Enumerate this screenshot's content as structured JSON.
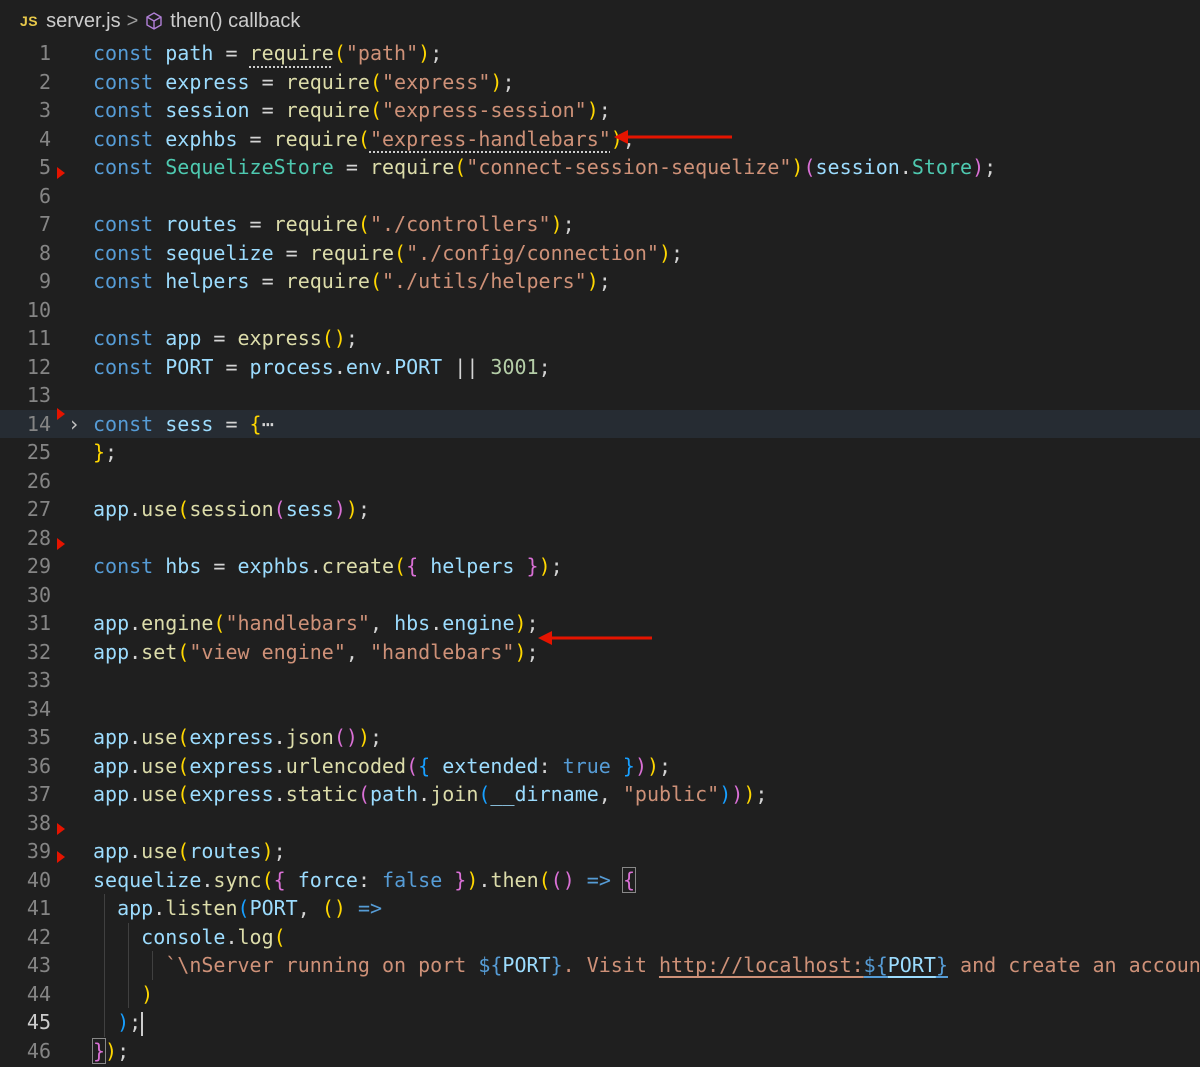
{
  "breadcrumb": {
    "file_badge": "JS",
    "file_name": "server.js",
    "separator": ">",
    "symbol": "then() callback"
  },
  "editor": {
    "current_line": "45",
    "lines": [
      {
        "n": "1",
        "tokens": [
          [
            "kw",
            "const "
          ],
          [
            "vr",
            "path"
          ],
          [
            "op",
            " = "
          ],
          [
            "fn dots",
            "require"
          ],
          [
            "b1",
            "("
          ],
          [
            "st",
            "\"path\""
          ],
          [
            "b1",
            ")"
          ],
          [
            "op",
            ";"
          ]
        ]
      },
      {
        "n": "2",
        "tokens": [
          [
            "kw",
            "const "
          ],
          [
            "vr",
            "express"
          ],
          [
            "op",
            " = "
          ],
          [
            "fn",
            "require"
          ],
          [
            "b1",
            "("
          ],
          [
            "st",
            "\"express\""
          ],
          [
            "b1",
            ")"
          ],
          [
            "op",
            ";"
          ]
        ]
      },
      {
        "n": "3",
        "tokens": [
          [
            "kw",
            "const "
          ],
          [
            "vr",
            "session"
          ],
          [
            "op",
            " = "
          ],
          [
            "fn",
            "require"
          ],
          [
            "b1",
            "("
          ],
          [
            "st",
            "\"express-session\""
          ],
          [
            "b1",
            ")"
          ],
          [
            "op",
            ";"
          ]
        ]
      },
      {
        "n": "4",
        "tokens": [
          [
            "kw",
            "const "
          ],
          [
            "vr",
            "exphbs"
          ],
          [
            "op",
            " = "
          ],
          [
            "fn",
            "require"
          ],
          [
            "b1",
            "("
          ],
          [
            "st dots",
            "\"express-handlebars\""
          ],
          [
            "b1",
            ")"
          ],
          [
            "op",
            ";"
          ]
        ]
      },
      {
        "n": "5",
        "tokens": [
          [
            "kw",
            "const "
          ],
          [
            "cl",
            "SequelizeStore"
          ],
          [
            "op",
            " = "
          ],
          [
            "fn",
            "require"
          ],
          [
            "b1",
            "("
          ],
          [
            "st",
            "\"connect-session-sequelize\""
          ],
          [
            "b1",
            ")"
          ],
          [
            "b2",
            "("
          ],
          [
            "vr",
            "session"
          ],
          [
            "op",
            "."
          ],
          [
            "cl",
            "Store"
          ],
          [
            "b2",
            ")"
          ],
          [
            "op",
            ";"
          ]
        ]
      },
      {
        "n": "6",
        "tokens": []
      },
      {
        "n": "7",
        "tokens": [
          [
            "kw",
            "const "
          ],
          [
            "vr",
            "routes"
          ],
          [
            "op",
            " = "
          ],
          [
            "fn",
            "require"
          ],
          [
            "b1",
            "("
          ],
          [
            "st",
            "\"./controllers\""
          ],
          [
            "b1",
            ")"
          ],
          [
            "op",
            ";"
          ]
        ]
      },
      {
        "n": "8",
        "tokens": [
          [
            "kw",
            "const "
          ],
          [
            "vr",
            "sequelize"
          ],
          [
            "op",
            " = "
          ],
          [
            "fn",
            "require"
          ],
          [
            "b1",
            "("
          ],
          [
            "st",
            "\"./config/connection\""
          ],
          [
            "b1",
            ")"
          ],
          [
            "op",
            ";"
          ]
        ]
      },
      {
        "n": "9",
        "tokens": [
          [
            "kw",
            "const "
          ],
          [
            "vr",
            "helpers"
          ],
          [
            "op",
            " = "
          ],
          [
            "fn",
            "require"
          ],
          [
            "b1",
            "("
          ],
          [
            "st",
            "\"./utils/helpers\""
          ],
          [
            "b1",
            ")"
          ],
          [
            "op",
            ";"
          ]
        ]
      },
      {
        "n": "10",
        "tokens": []
      },
      {
        "n": "11",
        "tokens": [
          [
            "kw",
            "const "
          ],
          [
            "vr",
            "app"
          ],
          [
            "op",
            " = "
          ],
          [
            "fn",
            "express"
          ],
          [
            "b1",
            "()"
          ],
          [
            "op",
            ";"
          ]
        ]
      },
      {
        "n": "12",
        "tokens": [
          [
            "kw",
            "const "
          ],
          [
            "vr",
            "PORT"
          ],
          [
            "op",
            " = "
          ],
          [
            "vr",
            "process"
          ],
          [
            "op",
            "."
          ],
          [
            "vr",
            "env"
          ],
          [
            "op",
            "."
          ],
          [
            "vr",
            "PORT"
          ],
          [
            "op",
            " || "
          ],
          [
            "nm",
            "3001"
          ],
          [
            "op",
            ";"
          ]
        ]
      },
      {
        "n": "13",
        "tokens": []
      },
      {
        "n": "14",
        "tokens": [
          [
            "kw",
            "const "
          ],
          [
            "vr",
            "sess"
          ],
          [
            "op",
            " = "
          ],
          [
            "b1",
            "{"
          ],
          [
            "op",
            "⋯"
          ]
        ]
      },
      {
        "n": "25",
        "tokens": [
          [
            "b1",
            "}"
          ],
          [
            "op",
            ";"
          ]
        ]
      },
      {
        "n": "26",
        "tokens": []
      },
      {
        "n": "27",
        "tokens": [
          [
            "vr",
            "app"
          ],
          [
            "op",
            "."
          ],
          [
            "fn",
            "use"
          ],
          [
            "b1",
            "("
          ],
          [
            "fn",
            "session"
          ],
          [
            "b2",
            "("
          ],
          [
            "vr",
            "sess"
          ],
          [
            "b2",
            ")"
          ],
          [
            "b1",
            ")"
          ],
          [
            "op",
            ";"
          ]
        ]
      },
      {
        "n": "28",
        "tokens": []
      },
      {
        "n": "29",
        "tokens": [
          [
            "kw",
            "const "
          ],
          [
            "vr",
            "hbs"
          ],
          [
            "op",
            " = "
          ],
          [
            "vr",
            "exphbs"
          ],
          [
            "op",
            "."
          ],
          [
            "fn",
            "create"
          ],
          [
            "b1",
            "("
          ],
          [
            "b2",
            "{ "
          ],
          [
            "vr",
            "helpers"
          ],
          [
            "b2",
            " }"
          ],
          [
            "b1",
            ")"
          ],
          [
            "op",
            ";"
          ]
        ]
      },
      {
        "n": "30",
        "tokens": []
      },
      {
        "n": "31",
        "tokens": [
          [
            "vr",
            "app"
          ],
          [
            "op",
            "."
          ],
          [
            "fn",
            "engine"
          ],
          [
            "b1",
            "("
          ],
          [
            "st",
            "\"handlebars\""
          ],
          [
            "op",
            ", "
          ],
          [
            "vr",
            "hbs"
          ],
          [
            "op",
            "."
          ],
          [
            "vr",
            "engine"
          ],
          [
            "b1",
            ")"
          ],
          [
            "op",
            ";"
          ]
        ]
      },
      {
        "n": "32",
        "tokens": [
          [
            "vr",
            "app"
          ],
          [
            "op",
            "."
          ],
          [
            "fn",
            "set"
          ],
          [
            "b1",
            "("
          ],
          [
            "st",
            "\"view engine\""
          ],
          [
            "op",
            ", "
          ],
          [
            "st",
            "\"handlebars\""
          ],
          [
            "b1",
            ")"
          ],
          [
            "op",
            ";"
          ]
        ]
      },
      {
        "n": "33",
        "tokens": []
      },
      {
        "n": "34",
        "tokens": []
      },
      {
        "n": "35",
        "tokens": [
          [
            "vr",
            "app"
          ],
          [
            "op",
            "."
          ],
          [
            "fn",
            "use"
          ],
          [
            "b1",
            "("
          ],
          [
            "vr",
            "express"
          ],
          [
            "op",
            "."
          ],
          [
            "fn",
            "json"
          ],
          [
            "b2",
            "()"
          ],
          [
            "b1",
            ")"
          ],
          [
            "op",
            ";"
          ]
        ]
      },
      {
        "n": "36",
        "tokens": [
          [
            "vr",
            "app"
          ],
          [
            "op",
            "."
          ],
          [
            "fn",
            "use"
          ],
          [
            "b1",
            "("
          ],
          [
            "vr",
            "express"
          ],
          [
            "op",
            "."
          ],
          [
            "fn",
            "urlencoded"
          ],
          [
            "b2",
            "("
          ],
          [
            "b3",
            "{ "
          ],
          [
            "vr",
            "extended"
          ],
          [
            "op",
            ": "
          ],
          [
            "kw",
            "true"
          ],
          [
            "b3",
            " }"
          ],
          [
            "b2",
            ")"
          ],
          [
            "b1",
            ")"
          ],
          [
            "op",
            ";"
          ]
        ]
      },
      {
        "n": "37",
        "tokens": [
          [
            "vr",
            "app"
          ],
          [
            "op",
            "."
          ],
          [
            "fn",
            "use"
          ],
          [
            "b1",
            "("
          ],
          [
            "vr",
            "express"
          ],
          [
            "op",
            "."
          ],
          [
            "fn",
            "static"
          ],
          [
            "b2",
            "("
          ],
          [
            "vr",
            "path"
          ],
          [
            "op",
            "."
          ],
          [
            "fn",
            "join"
          ],
          [
            "b3",
            "("
          ],
          [
            "vr",
            "__dirname"
          ],
          [
            "op",
            ", "
          ],
          [
            "st",
            "\"public\""
          ],
          [
            "b3",
            ")"
          ],
          [
            "b2",
            ")"
          ],
          [
            "b1",
            ")"
          ],
          [
            "op",
            ";"
          ]
        ]
      },
      {
        "n": "38",
        "tokens": []
      },
      {
        "n": "39",
        "tokens": [
          [
            "vr",
            "app"
          ],
          [
            "op",
            "."
          ],
          [
            "fn",
            "use"
          ],
          [
            "b1",
            "("
          ],
          [
            "vr",
            "routes"
          ],
          [
            "b1",
            ")"
          ],
          [
            "op",
            ";"
          ]
        ]
      },
      {
        "n": "40",
        "tokens": [
          [
            "vr",
            "sequelize"
          ],
          [
            "op",
            "."
          ],
          [
            "fn",
            "sync"
          ],
          [
            "b1",
            "("
          ],
          [
            "b2",
            "{ "
          ],
          [
            "vr",
            "force"
          ],
          [
            "op",
            ": "
          ],
          [
            "kw",
            "false"
          ],
          [
            "b2",
            " }"
          ],
          [
            "b1",
            ")"
          ],
          [
            "op",
            "."
          ],
          [
            "fn",
            "then"
          ],
          [
            "b1",
            "("
          ],
          [
            "b2",
            "()"
          ],
          [
            "kw",
            " => "
          ],
          [
            "b2 boxb",
            "{"
          ]
        ]
      },
      {
        "n": "41",
        "tokens": [
          [
            "op",
            "  "
          ],
          [
            "vr",
            "app"
          ],
          [
            "op",
            "."
          ],
          [
            "fn",
            "listen"
          ],
          [
            "b3",
            "("
          ],
          [
            "vr",
            "PORT"
          ],
          [
            "op",
            ", "
          ],
          [
            "b1",
            "()"
          ],
          [
            "kw",
            " =>"
          ]
        ]
      },
      {
        "n": "42",
        "tokens": [
          [
            "op",
            "    "
          ],
          [
            "vr",
            "console"
          ],
          [
            "op",
            "."
          ],
          [
            "fn",
            "log"
          ],
          [
            "b1",
            "("
          ]
        ]
      },
      {
        "n": "43",
        "tokens": [
          [
            "op",
            "      "
          ],
          [
            "st",
            "`\\nServer running on port "
          ],
          [
            "kw",
            "${"
          ],
          [
            "vr",
            "PORT"
          ],
          [
            "kw",
            "}"
          ],
          [
            "st",
            ". Visit "
          ],
          [
            "st ul",
            "http://localhost:"
          ],
          [
            "kw ul",
            "${"
          ],
          [
            "vr ul",
            "PORT"
          ],
          [
            "kw ul",
            "}"
          ],
          [
            "st",
            " and create an account!`"
          ]
        ]
      },
      {
        "n": "44",
        "tokens": [
          [
            "op",
            "    "
          ],
          [
            "b1",
            ")"
          ]
        ]
      },
      {
        "n": "45",
        "tokens": [
          [
            "op",
            "  "
          ],
          [
            "b3",
            ")"
          ],
          [
            "op",
            ";"
          ]
        ]
      },
      {
        "n": "46",
        "tokens": [
          [
            "b2 boxb",
            "}"
          ],
          [
            "b1",
            ")"
          ],
          [
            "op",
            ";"
          ]
        ]
      }
    ]
  }
}
